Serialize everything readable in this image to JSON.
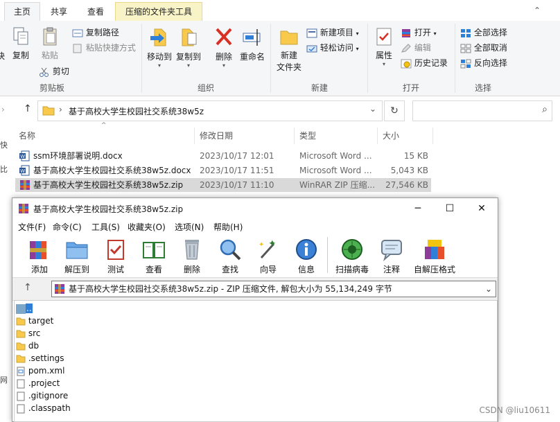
{
  "explorer": {
    "tabs": [
      "主页",
      "共享",
      "查看",
      "压缩的文件夹工具"
    ],
    "ribbon": {
      "clipboard": {
        "cut_partial": "快",
        "copy": "复制",
        "paste": "粘贴",
        "copy_path": "复制路径",
        "paste_shortcut": "粘贴快捷方式",
        "cut": "剪切",
        "label": "剪贴板"
      },
      "organize": {
        "move_to": "移动到",
        "copy_to": "复制到",
        "delete": "删除",
        "rename": "重命名",
        "label": "组织"
      },
      "new": {
        "new_folder_line1": "新建",
        "new_folder_line2": "文件夹",
        "new_item": "新建项目",
        "easy_access": "轻松访问",
        "label": "新建"
      },
      "open": {
        "properties": "属性",
        "open": "打开",
        "edit": "编辑",
        "history": "历史记录",
        "label": "打开"
      },
      "select": {
        "select_all": "全部选择",
        "select_none": "全部取消",
        "invert": "反向选择",
        "label": "选择"
      }
    },
    "address": {
      "path": "基于高校大学生校园社交系统38w5z"
    },
    "columns": [
      "名称",
      "修改日期",
      "类型",
      "大小"
    ],
    "files": [
      {
        "name": "ssm环境部署说明.docx",
        "date": "2023/10/17 12:01",
        "type": "Microsoft Word ...",
        "size": "15 KB",
        "kind": "word"
      },
      {
        "name": "基于高校大学生校园社交系统38w5z.docx",
        "date": "2023/10/17 11:51",
        "type": "Microsoft Word ...",
        "size": "5,043 KB",
        "kind": "word"
      },
      {
        "name": "基于高校大学生校园社交系统38w5z.zip",
        "date": "2023/10/17 11:10",
        "type": "WinRAR ZIP 压缩...",
        "size": "27,546 KB",
        "kind": "rar"
      }
    ],
    "left_nav_partial": [
      "快",
      "比",
      "网"
    ]
  },
  "rar": {
    "title": "基于高校大学生校园社交系统38w5z.zip",
    "menus": [
      "文件(F)",
      "命令(C)",
      "工具(S)",
      "收藏夹(O)",
      "选项(N)",
      "帮助(H)"
    ],
    "tools": [
      "添加",
      "解压到",
      "测试",
      "查看",
      "删除",
      "查找",
      "向导",
      "信息",
      "扫描病毒",
      "注释",
      "自解压格式"
    ],
    "path": "基于高校大学生校园社交系统38w5z.zip - ZIP 压缩文件, 解包大小为 55,134,249 字节",
    "items": [
      {
        "name": "..",
        "kind": "up"
      },
      {
        "name": "target",
        "kind": "folder"
      },
      {
        "name": "src",
        "kind": "folder"
      },
      {
        "name": "db",
        "kind": "folder"
      },
      {
        "name": ".settings",
        "kind": "folder"
      },
      {
        "name": "pom.xml",
        "kind": "file"
      },
      {
        "name": ".project",
        "kind": "file"
      },
      {
        "name": ".gitignore",
        "kind": "file"
      },
      {
        "name": ".classpath",
        "kind": "file"
      }
    ]
  },
  "watermark": "CSDN @liu10611",
  "colors": {
    "folder": "#f8c94b",
    "selection": "#d9d9d9",
    "tool_tab": "#f9f3c8",
    "delete_red": "#d93025"
  }
}
